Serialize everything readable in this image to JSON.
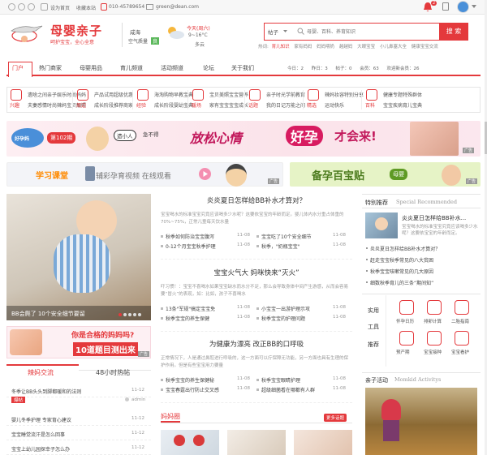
{
  "topbar": {
    "home_label": "设为首页",
    "fav_label": "收藏本站",
    "phone": "010-45789654",
    "email": "green@dean.com",
    "notif_count": "2"
  },
  "brand": {
    "name": "母婴亲子",
    "slogan": "呵护宝宝，全心全意",
    "city": "咸海",
    "air": "空气质量",
    "air_value": "良",
    "weather": "今天(周六)",
    "temp": "9~16°C",
    "weather_desc": "多云"
  },
  "search": {
    "select": "帖子",
    "placeholder": "母婴、百科、养育知识",
    "button": "搜 索",
    "hot_label": "热词:",
    "hot_words": [
      "育儿知识",
      "家有妈妈",
      "妈妈喂奶",
      "越越妈",
      "大眼宝宝",
      "小儿鼻塞大全",
      "健康宝宝交流"
    ]
  },
  "nav": {
    "items": [
      "门户",
      "热门商家",
      "母婴用品",
      "育儿频道",
      "活动频道",
      "论坛",
      "关于我们"
    ],
    "stats": [
      "今日：2",
      "昨日：3",
      "帖子：0",
      "会员：63",
      "欢迎新会员：26"
    ]
  },
  "categories": [
    {
      "label": "兴趣",
      "links": [
        "遗啥之间",
        "夫妻感情",
        "亲子娱乐",
        "时尚辣妈",
        "时尚妈妈",
        "宝贝靓照"
      ]
    },
    {
      "label": "周边",
      "links": [
        "产品试用",
        "成长阶段",
        "超级优惠",
        "推荐商家"
      ]
    },
    {
      "label": "经验",
      "links": [
        "海淘购物",
        "成长阶段",
        "早教宝典",
        "婴幼宝典"
      ]
    },
    {
      "label": "暖场",
      "links": [
        "宝贝美照",
        "家有宝宝",
        "宝宝营养",
        "宝宝成长"
      ]
    },
    {
      "label": "话题",
      "links": [
        "亲子时光",
        "我的日记",
        "学前教育",
        "万能之间"
      ]
    },
    {
      "label": "精选",
      "links": [
        "辣妈妆容",
        "运动快乐",
        "特别分享"
      ]
    },
    {
      "label": "百科",
      "links": [
        "健康专题",
        "宝宝疾病",
        "特殊群体",
        "育儿宝典"
      ]
    }
  ],
  "banner1": {
    "brand": "好孕妈",
    "issue": "第102期",
    "tag1": "遗小人",
    "tag2": "急不得",
    "slogan": "放松心情",
    "slogan2": "好孕",
    "slogan3": "才会来!",
    "ad": "广告"
  },
  "banner2": {
    "left": "学习课堂",
    "text": "辅彩孕育视频  在线观看",
    "ad": "广告"
  },
  "banner3": {
    "text": "备孕百宝贴",
    "tag": "母婴",
    "ad": "广告"
  },
  "slider": {
    "caption": "BB会爬了 10个安全细节要留"
  },
  "quiz_banner": {
    "line1": "你是合格的妈妈吗?",
    "line2": "10道题目测出来",
    "ad": "广告"
  },
  "tabs": {
    "active": "辣妈交流",
    "other": "48小时热帖"
  },
  "left_list": [
    {
      "title": "冬季让BB头头到脚都暖和的法则",
      "tag": "爆帖",
      "date": "11-12"
    },
    {
      "title": "婴儿冬季护理 专家育心建议",
      "date": "11-12",
      "author": "admin"
    },
    {
      "title": "宝宝睡觉流汗是怎么回事",
      "date": "11-12"
    },
    {
      "title": "宝宝上幼儿园探幸子怎么办",
      "date": "11-12"
    }
  ],
  "feature1": {
    "title": "炎炎夏日怎样给BB补水才算对？",
    "desc": "宝宝喝水的标准宝宝究竟应该喝多少水呢？这要依宝宝的年龄而定。婴儿体内水分重占体重的70%~75%，正常儿童每天饮水量",
    "items": [
      {
        "t": "秋季如何防治宝宝腹泻",
        "d": "11-08"
      },
      {
        "t": "宝宝吃了10个安全细节",
        "d": "11-08"
      },
      {
        "t": "0-12个月宝宝秋季护理",
        "d": "11-08"
      },
      {
        "t": "秋季，\"奶瓶宝宝\"",
        "d": "11-08"
      }
    ]
  },
  "feature2": {
    "title": "宝宝火气大 妈咪快来“灭火”",
    "desc": "吓习惯！：宝宝不喜喝水如果宝宝缺水而水分不足，那么会导致身体中间产生游感，从而会容易要“冒火”的表现，如：比如，孩子不喜喝水",
    "items": [
      {
        "t": "13条\"军规\"搞定宝宝免",
        "d": "11-08"
      },
      {
        "t": "小宝宝一出游护理示攻",
        "d": "11-08"
      },
      {
        "t": "秋季宝宝的养生保健",
        "d": "11-08"
      },
      {
        "t": "秋季宝宝的护理问题",
        "d": "11-08"
      }
    ]
  },
  "feature3": {
    "title": "为健康为漂亮 改正BB的口呼吸",
    "desc": "正常情况下，人是通过鼻腔进行呼吸的，这一方面可以疗保障无功能，另一方面也具有生理的保护作用。但是有些宝宝用力要量",
    "items": [
      {
        "t": "秋季宝宝的养生保健秘",
        "d": "11-08"
      },
      {
        "t": "秋季宝宝眼睛护理",
        "d": "11-08"
      },
      {
        "t": "宝宝春霆出行防止交叉感",
        "d": "11-08"
      },
      {
        "t": "超级细菌看在哪都有人群",
        "d": "11-08"
      }
    ]
  },
  "mom_circle": {
    "title": "妈妈圈",
    "more": "更多话题"
  },
  "special": {
    "title": "特别推荐",
    "title_en": "Special Recommended",
    "top_title": "炎炎夏日怎样给BB补水...",
    "top_desc": "宝宝喝水的标准宝宝究竟应该喝多少水呢？这要依宝宝的年龄而定。",
    "links": [
      "炎炎夏日怎样给BB补水才算对？",
      "赶走宝宝秋季常见的八大贫困",
      "秋季宝宝咳嗽常见的几大原因",
      "细数秋季育儿的三条“期间知”"
    ]
  },
  "tools": {
    "label": [
      "实用",
      "工具",
      "推荐"
    ],
    "items": [
      "怀孕日历",
      "排卵计算",
      "二胎指南",
      "预产期",
      "宝宝接种",
      "宝宝看护"
    ]
  },
  "activity": {
    "title": "亲子活动",
    "title_en": "Momkid Activitys"
  },
  "colors": {
    "accent": "#e4393c",
    "border": "#e5e5e5",
    "muted": "#999999"
  }
}
